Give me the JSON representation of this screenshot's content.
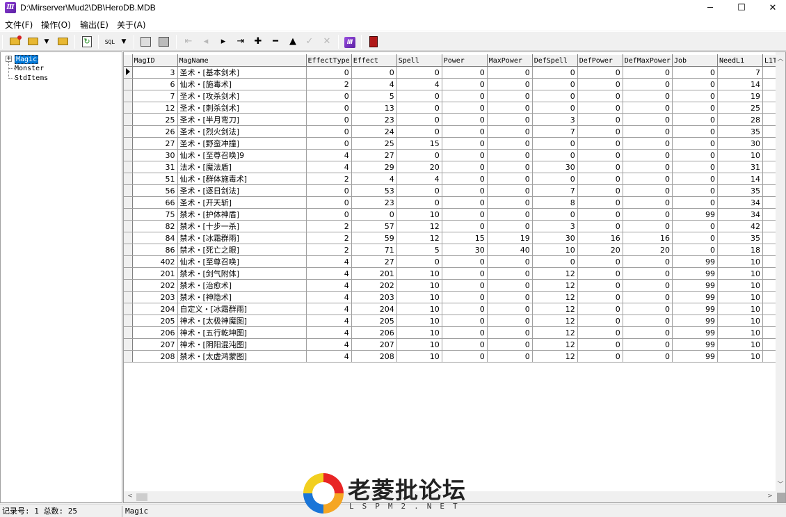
{
  "window": {
    "title": "D:\\Mirserver\\Mud2\\DB\\HeroDB.MDB",
    "app_icon_label": "Ⅲ",
    "controls": {
      "minimize": "─",
      "maximize": "☐",
      "close": "✕"
    }
  },
  "menu": [
    "文件(F)",
    "操作(O)",
    "输出(E)",
    "关于(A)"
  ],
  "toolbar": {
    "sql_label": "SQL",
    "nav_glyphs": [
      "⇤",
      "◂",
      "▸",
      "⇥",
      "✚",
      "━",
      "▲",
      "✓",
      "✕"
    ]
  },
  "tree": {
    "expander": "+",
    "nodes": [
      "Magic",
      "Monster",
      "StdItems"
    ],
    "selected": "Magic"
  },
  "grid": {
    "columns": [
      "MagID",
      "MagName",
      "EffectType",
      "Effect",
      "Spell",
      "Power",
      "MaxPower",
      "DefSpell",
      "DefPower",
      "DefMaxPower",
      "Job",
      "NeedL1",
      "L1T"
    ],
    "rows": [
      [
        "3",
        "圣术・[基本剑术]",
        "0",
        "0",
        "0",
        "0",
        "0",
        "0",
        "0",
        "0",
        "0",
        "7"
      ],
      [
        "6",
        "仙术・[施毒术]",
        "2",
        "4",
        "4",
        "0",
        "0",
        "0",
        "0",
        "0",
        "0",
        "14"
      ],
      [
        "7",
        "圣术・[攻杀剑术]",
        "0",
        "5",
        "0",
        "0",
        "0",
        "0",
        "0",
        "0",
        "0",
        "19"
      ],
      [
        "12",
        "圣术・[刺杀剑术]",
        "0",
        "13",
        "0",
        "0",
        "0",
        "0",
        "0",
        "0",
        "0",
        "25"
      ],
      [
        "25",
        "圣术・[半月弯刀]",
        "0",
        "23",
        "0",
        "0",
        "0",
        "3",
        "0",
        "0",
        "0",
        "28"
      ],
      [
        "26",
        "圣术・[烈火剑法]",
        "0",
        "24",
        "0",
        "0",
        "0",
        "7",
        "0",
        "0",
        "0",
        "35"
      ],
      [
        "27",
        "圣术・[野蛮冲撞]",
        "0",
        "25",
        "15",
        "0",
        "0",
        "0",
        "0",
        "0",
        "0",
        "30"
      ],
      [
        "30",
        "仙术・[至尊召唤]9",
        "4",
        "27",
        "0",
        "0",
        "0",
        "0",
        "0",
        "0",
        "0",
        "10"
      ],
      [
        "31",
        "法术・[魔法盾]",
        "4",
        "29",
        "20",
        "0",
        "0",
        "30",
        "0",
        "0",
        "0",
        "31"
      ],
      [
        "51",
        "仙术・[群体施毒术]",
        "2",
        "4",
        "4",
        "0",
        "0",
        "0",
        "0",
        "0",
        "0",
        "14"
      ],
      [
        "56",
        "圣术・[逐日剑法]",
        "0",
        "53",
        "0",
        "0",
        "0",
        "7",
        "0",
        "0",
        "0",
        "35"
      ],
      [
        "66",
        "圣术・[开天斩]",
        "0",
        "23",
        "0",
        "0",
        "0",
        "8",
        "0",
        "0",
        "0",
        "34"
      ],
      [
        "75",
        "禁术・[护体神盾]",
        "0",
        "0",
        "10",
        "0",
        "0",
        "0",
        "0",
        "0",
        "99",
        "34"
      ],
      [
        "82",
        "禁术・[十步一杀]",
        "2",
        "57",
        "12",
        "0",
        "0",
        "3",
        "0",
        "0",
        "0",
        "42"
      ],
      [
        "84",
        "禁术・[冰霜群雨]",
        "2",
        "59",
        "12",
        "15",
        "19",
        "30",
        "16",
        "16",
        "0",
        "35"
      ],
      [
        "86",
        "禁术・[死亡之眼]",
        "2",
        "71",
        "5",
        "30",
        "40",
        "10",
        "20",
        "20",
        "0",
        "18"
      ],
      [
        "402",
        "仙术・[至尊召唤]",
        "4",
        "27",
        "0",
        "0",
        "0",
        "0",
        "0",
        "0",
        "99",
        "10"
      ],
      [
        "201",
        "禁术・[剑气附体]",
        "4",
        "201",
        "10",
        "0",
        "0",
        "12",
        "0",
        "0",
        "99",
        "10"
      ],
      [
        "202",
        "禁术・[治愈术]",
        "4",
        "202",
        "10",
        "0",
        "0",
        "12",
        "0",
        "0",
        "99",
        "10"
      ],
      [
        "203",
        "禁术・[神隐术]",
        "4",
        "203",
        "10",
        "0",
        "0",
        "12",
        "0",
        "0",
        "99",
        "10"
      ],
      [
        "204",
        "自定义・[冰霜群雨]",
        "4",
        "204",
        "10",
        "0",
        "0",
        "12",
        "0",
        "0",
        "99",
        "10"
      ],
      [
        "205",
        "神术・[太极神魔图]",
        "4",
        "205",
        "10",
        "0",
        "0",
        "12",
        "0",
        "0",
        "99",
        "10"
      ],
      [
        "206",
        "神术・[五行乾坤图]",
        "4",
        "206",
        "10",
        "0",
        "0",
        "12",
        "0",
        "0",
        "99",
        "10"
      ],
      [
        "207",
        "神术・[阴阳混沌图]",
        "4",
        "207",
        "10",
        "0",
        "0",
        "12",
        "0",
        "0",
        "99",
        "10"
      ],
      [
        "208",
        "禁术・[太虚鸿蒙图]",
        "4",
        "208",
        "10",
        "0",
        "0",
        "12",
        "0",
        "0",
        "99",
        "10"
      ]
    ]
  },
  "status": {
    "records": "记录号: 1 总数: 25",
    "table": "Magic"
  },
  "watermark": {
    "text": "老菱批论坛",
    "sub": "LSPM2.NET"
  }
}
